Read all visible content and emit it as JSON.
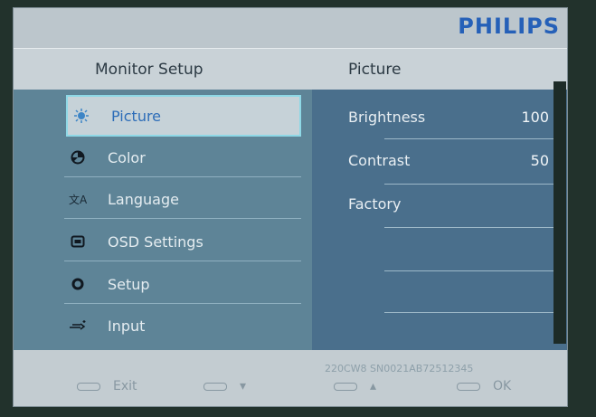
{
  "brand": {
    "logo_text": "PHILIPS"
  },
  "header": {
    "left_title": "Monitor Setup",
    "right_title": "Picture"
  },
  "menu": {
    "items": [
      {
        "label": "Picture",
        "icon": "picture-icon",
        "selected": true
      },
      {
        "label": "Color",
        "icon": "color-icon",
        "selected": false
      },
      {
        "label": "Language",
        "icon": "language-icon",
        "selected": false
      },
      {
        "label": "OSD Settings",
        "icon": "osd-settings-icon",
        "selected": false
      },
      {
        "label": "Setup",
        "icon": "setup-icon",
        "selected": false
      },
      {
        "label": "Input",
        "icon": "input-icon",
        "selected": false
      }
    ]
  },
  "picture_settings": {
    "brightness": {
      "label": "Brightness",
      "value": "100"
    },
    "contrast": {
      "label": "Contrast",
      "value": "50"
    },
    "factory": {
      "label": "Factory"
    }
  },
  "footer": {
    "model": "220CW8 SN0021AB72512345",
    "buttons": {
      "exit": "Exit",
      "down": "▾",
      "up": "▴",
      "ok": "OK"
    }
  },
  "colors": {
    "brand_blue": "#2560b8",
    "left_pane": "#5e8497",
    "right_pane": "#4a6f8c",
    "selected_highlight": "#8ed8e6"
  }
}
